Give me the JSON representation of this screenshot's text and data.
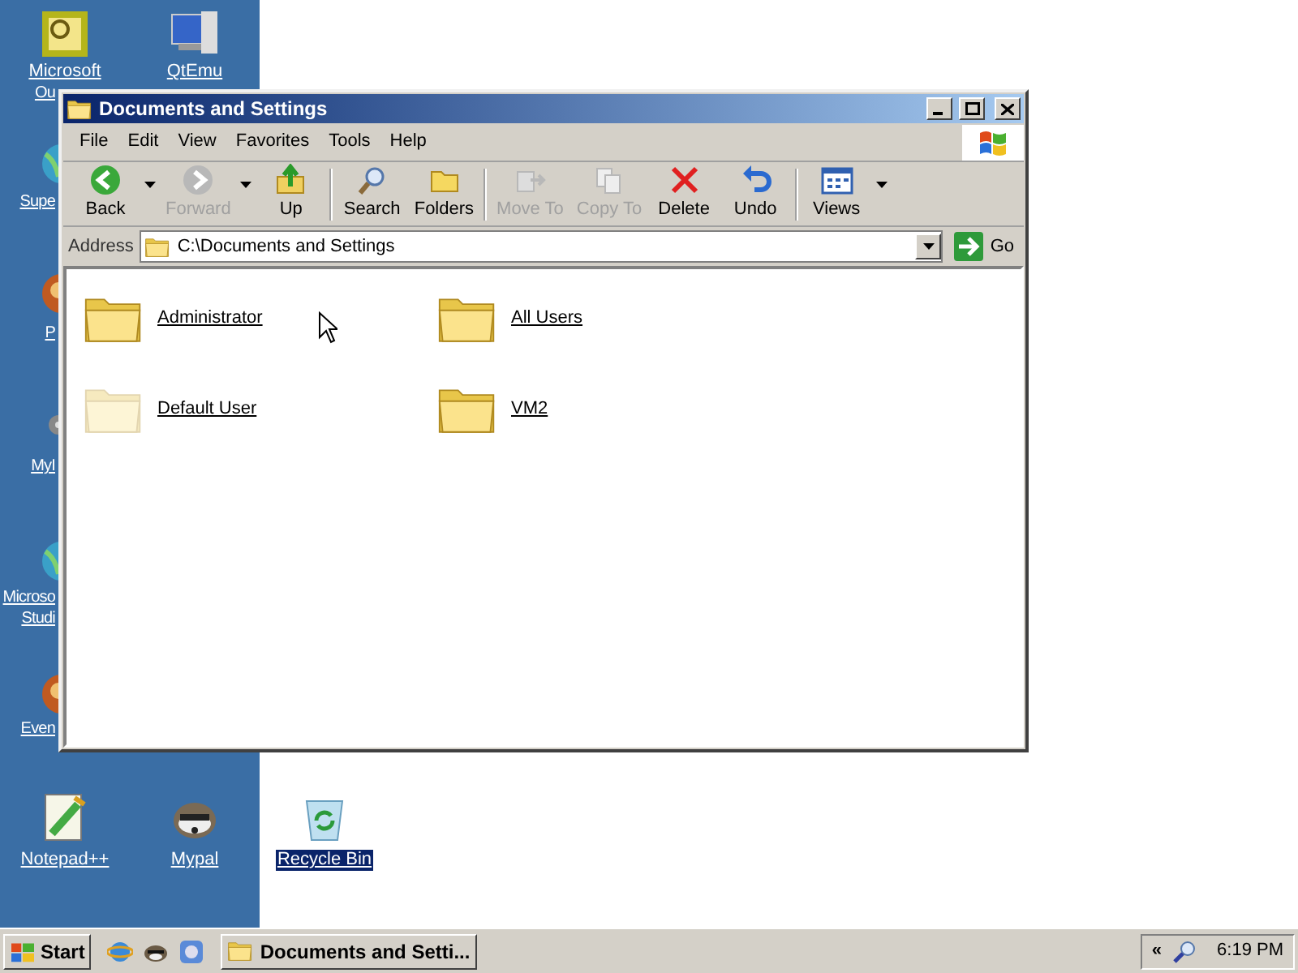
{
  "desktop_icons": [
    {
      "kind": "outlook",
      "label": [
        "Microsoft",
        "Ou"
      ],
      "selected": false
    },
    {
      "kind": "qtemu",
      "label": [
        "QtEmu"
      ],
      "selected": false
    },
    {
      "kind": "globe",
      "label": [
        "Supe"
      ],
      "selected": false
    },
    {
      "kind": "orb",
      "label": [
        "P"
      ],
      "selected": false
    },
    {
      "kind": "gear",
      "label": [
        "MyI"
      ],
      "selected": false
    },
    {
      "kind": "globe",
      "label": [
        "Microso",
        "Studi"
      ],
      "selected": false
    },
    {
      "kind": "orb",
      "label": [
        "Even"
      ],
      "selected": false
    },
    {
      "kind": "notepad",
      "label": [
        "Notepad++"
      ],
      "selected": false
    },
    {
      "kind": "raccoon",
      "label": [
        "Mypal"
      ],
      "selected": false
    },
    {
      "kind": "recycle",
      "label": [
        "Recycle Bin"
      ],
      "selected": true
    }
  ],
  "window": {
    "title": "Documents and Settings",
    "menu": [
      "File",
      "Edit",
      "View",
      "Favorites",
      "Tools",
      "Help"
    ],
    "toolbar": [
      {
        "kind": "back",
        "label": "Back",
        "disabled": false,
        "dropdown": true
      },
      {
        "kind": "forward",
        "label": "Forward",
        "disabled": true,
        "dropdown": true
      },
      {
        "kind": "up",
        "label": "Up",
        "disabled": false,
        "dropdown": false
      },
      {
        "kind": "separator"
      },
      {
        "kind": "search",
        "label": "Search",
        "disabled": false,
        "dropdown": false
      },
      {
        "kind": "folders",
        "label": "Folders",
        "disabled": false,
        "dropdown": false
      },
      {
        "kind": "separator"
      },
      {
        "kind": "moveto",
        "label": "Move To",
        "disabled": true,
        "dropdown": false
      },
      {
        "kind": "copyto",
        "label": "Copy To",
        "disabled": true,
        "dropdown": false
      },
      {
        "kind": "delete",
        "label": "Delete",
        "disabled": false,
        "dropdown": false
      },
      {
        "kind": "undo",
        "label": "Undo",
        "disabled": false,
        "dropdown": false
      },
      {
        "kind": "separator"
      },
      {
        "kind": "views",
        "label": "Views",
        "disabled": false,
        "dropdown": true
      }
    ],
    "address": {
      "label": "Address",
      "value": "C:\\Documents and Settings",
      "go": "Go"
    },
    "items": [
      {
        "name": "Administrator",
        "hidden": false
      },
      {
        "name": "All Users",
        "hidden": false
      },
      {
        "name": "Default User",
        "hidden": true
      },
      {
        "name": "VM2",
        "hidden": false
      }
    ]
  },
  "taskbar": {
    "start": "Start",
    "quick_launch": [
      {
        "kind": "browser"
      },
      {
        "kind": "raccoon"
      },
      {
        "kind": "app"
      }
    ],
    "task_button": {
      "label": "Documents and Setti..."
    },
    "tray": {
      "chevron": "«",
      "time": "6:19 PM"
    }
  }
}
